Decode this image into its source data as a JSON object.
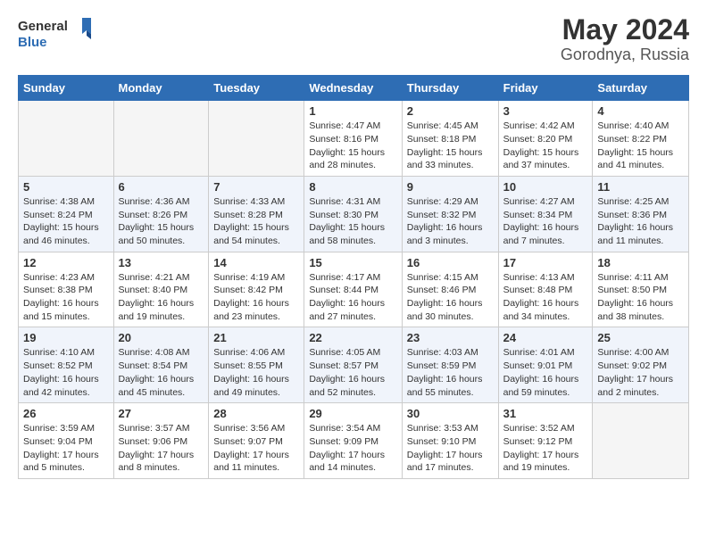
{
  "logo": {
    "general": "General",
    "blue": "Blue"
  },
  "title": "May 2024",
  "subtitle": "Gorodnya, Russia",
  "days_header": [
    "Sunday",
    "Monday",
    "Tuesday",
    "Wednesday",
    "Thursday",
    "Friday",
    "Saturday"
  ],
  "weeks": [
    {
      "shade": false,
      "days": [
        {
          "num": "",
          "info": ""
        },
        {
          "num": "",
          "info": ""
        },
        {
          "num": "",
          "info": ""
        },
        {
          "num": "1",
          "info": "Sunrise: 4:47 AM\nSunset: 8:16 PM\nDaylight: 15 hours\nand 28 minutes."
        },
        {
          "num": "2",
          "info": "Sunrise: 4:45 AM\nSunset: 8:18 PM\nDaylight: 15 hours\nand 33 minutes."
        },
        {
          "num": "3",
          "info": "Sunrise: 4:42 AM\nSunset: 8:20 PM\nDaylight: 15 hours\nand 37 minutes."
        },
        {
          "num": "4",
          "info": "Sunrise: 4:40 AM\nSunset: 8:22 PM\nDaylight: 15 hours\nand 41 minutes."
        }
      ]
    },
    {
      "shade": true,
      "days": [
        {
          "num": "5",
          "info": "Sunrise: 4:38 AM\nSunset: 8:24 PM\nDaylight: 15 hours\nand 46 minutes."
        },
        {
          "num": "6",
          "info": "Sunrise: 4:36 AM\nSunset: 8:26 PM\nDaylight: 15 hours\nand 50 minutes."
        },
        {
          "num": "7",
          "info": "Sunrise: 4:33 AM\nSunset: 8:28 PM\nDaylight: 15 hours\nand 54 minutes."
        },
        {
          "num": "8",
          "info": "Sunrise: 4:31 AM\nSunset: 8:30 PM\nDaylight: 15 hours\nand 58 minutes."
        },
        {
          "num": "9",
          "info": "Sunrise: 4:29 AM\nSunset: 8:32 PM\nDaylight: 16 hours\nand 3 minutes."
        },
        {
          "num": "10",
          "info": "Sunrise: 4:27 AM\nSunset: 8:34 PM\nDaylight: 16 hours\nand 7 minutes."
        },
        {
          "num": "11",
          "info": "Sunrise: 4:25 AM\nSunset: 8:36 PM\nDaylight: 16 hours\nand 11 minutes."
        }
      ]
    },
    {
      "shade": false,
      "days": [
        {
          "num": "12",
          "info": "Sunrise: 4:23 AM\nSunset: 8:38 PM\nDaylight: 16 hours\nand 15 minutes."
        },
        {
          "num": "13",
          "info": "Sunrise: 4:21 AM\nSunset: 8:40 PM\nDaylight: 16 hours\nand 19 minutes."
        },
        {
          "num": "14",
          "info": "Sunrise: 4:19 AM\nSunset: 8:42 PM\nDaylight: 16 hours\nand 23 minutes."
        },
        {
          "num": "15",
          "info": "Sunrise: 4:17 AM\nSunset: 8:44 PM\nDaylight: 16 hours\nand 27 minutes."
        },
        {
          "num": "16",
          "info": "Sunrise: 4:15 AM\nSunset: 8:46 PM\nDaylight: 16 hours\nand 30 minutes."
        },
        {
          "num": "17",
          "info": "Sunrise: 4:13 AM\nSunset: 8:48 PM\nDaylight: 16 hours\nand 34 minutes."
        },
        {
          "num": "18",
          "info": "Sunrise: 4:11 AM\nSunset: 8:50 PM\nDaylight: 16 hours\nand 38 minutes."
        }
      ]
    },
    {
      "shade": true,
      "days": [
        {
          "num": "19",
          "info": "Sunrise: 4:10 AM\nSunset: 8:52 PM\nDaylight: 16 hours\nand 42 minutes."
        },
        {
          "num": "20",
          "info": "Sunrise: 4:08 AM\nSunset: 8:54 PM\nDaylight: 16 hours\nand 45 minutes."
        },
        {
          "num": "21",
          "info": "Sunrise: 4:06 AM\nSunset: 8:55 PM\nDaylight: 16 hours\nand 49 minutes."
        },
        {
          "num": "22",
          "info": "Sunrise: 4:05 AM\nSunset: 8:57 PM\nDaylight: 16 hours\nand 52 minutes."
        },
        {
          "num": "23",
          "info": "Sunrise: 4:03 AM\nSunset: 8:59 PM\nDaylight: 16 hours\nand 55 minutes."
        },
        {
          "num": "24",
          "info": "Sunrise: 4:01 AM\nSunset: 9:01 PM\nDaylight: 16 hours\nand 59 minutes."
        },
        {
          "num": "25",
          "info": "Sunrise: 4:00 AM\nSunset: 9:02 PM\nDaylight: 17 hours\nand 2 minutes."
        }
      ]
    },
    {
      "shade": false,
      "days": [
        {
          "num": "26",
          "info": "Sunrise: 3:59 AM\nSunset: 9:04 PM\nDaylight: 17 hours\nand 5 minutes."
        },
        {
          "num": "27",
          "info": "Sunrise: 3:57 AM\nSunset: 9:06 PM\nDaylight: 17 hours\nand 8 minutes."
        },
        {
          "num": "28",
          "info": "Sunrise: 3:56 AM\nSunset: 9:07 PM\nDaylight: 17 hours\nand 11 minutes."
        },
        {
          "num": "29",
          "info": "Sunrise: 3:54 AM\nSunset: 9:09 PM\nDaylight: 17 hours\nand 14 minutes."
        },
        {
          "num": "30",
          "info": "Sunrise: 3:53 AM\nSunset: 9:10 PM\nDaylight: 17 hours\nand 17 minutes."
        },
        {
          "num": "31",
          "info": "Sunrise: 3:52 AM\nSunset: 9:12 PM\nDaylight: 17 hours\nand 19 minutes."
        },
        {
          "num": "",
          "info": ""
        }
      ]
    }
  ]
}
